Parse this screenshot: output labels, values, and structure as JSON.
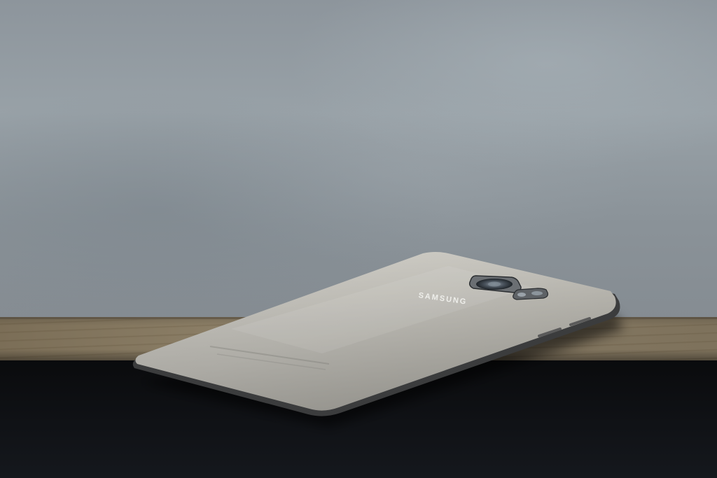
{
  "scene": {
    "brand_text": "SAMSUNG",
    "colors": {
      "sky": "#939ba1",
      "ledge_wood": "#857862",
      "floor_dark": "#0f1114",
      "phone_body": "#c9c7c0",
      "phone_rim": "#3a3a3a"
    }
  }
}
